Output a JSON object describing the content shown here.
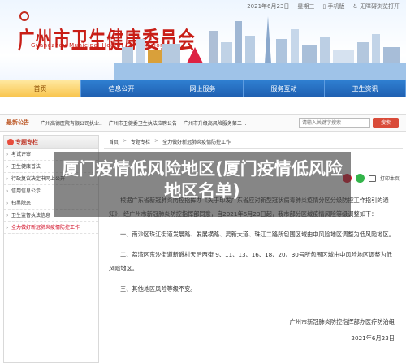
{
  "header": {
    "date": "2021年6月23日",
    "weekday": "星期三",
    "mobile_label": "手机版",
    "accessibility_label": "无障碍浏览打开",
    "site_title": "广州市卫生健康委员会",
    "site_title_en": "Guangzhou Municipal Health Commission"
  },
  "nav": [
    {
      "label": "首页"
    },
    {
      "label": "信息公开"
    },
    {
      "label": "网上服务"
    },
    {
      "label": "服务互动"
    },
    {
      "label": "卫生资讯"
    }
  ],
  "ticker": {
    "label": "最新公告",
    "items": [
      "广州高德医院有限公司执业..",
      "广州市卫健委卫生执法应聘公告",
      "广州市升级高风险服务第二 .."
    ],
    "search_placeholder": "请输入关键字搜索",
    "search_button": "搜索"
  },
  "sidebar": {
    "title": "专题专栏",
    "items": [
      {
        "label": "考试评审"
      },
      {
        "label": "卫生健康普法"
      },
      {
        "label": "行政复议决定书网上公开"
      },
      {
        "label": "信用信息公示"
      },
      {
        "label": "扫黑除恶"
      },
      {
        "label": "卫生监督执法信息"
      },
      {
        "label": "全力做好新冠肺炎疫情防控工作"
      }
    ]
  },
  "breadcrumb": [
    "首页",
    "专题专栏",
    "全力做好新冠肺炎疫情防控工作"
  ],
  "tools": {
    "print_label": "打印本页"
  },
  "overlay": {
    "title": "厦门疫情低风险地区(厦门疫情低风险地区名单)"
  },
  "article": {
    "intro": "根据广东省新冠肺炎防控指挥办《关于印发广东省应对新型冠状病毒肺炎疫情分区分级防控工作指引的通知》，经广州市新冠肺炎防控指挥部同意，自2021年6月23日起，我市部分区域疫情风险等级调整如下：",
    "item1": "一、南沙区珠江街道发展路、发展横路、灵新大道、珠江二路所包围区域由中风险地区调整为低风险地区。",
    "item2": "二、荔湾区东沙街道新爵村天后西街 9、11、13、16、18、20、30号所包围区域由中风险地区调整为低风险地区。",
    "item3": "三、其他地区风险等级不变。",
    "signature": "广州市新冠肺炎防控指挥部办医疗防治组",
    "sign_date": "2021年6月23日"
  }
}
